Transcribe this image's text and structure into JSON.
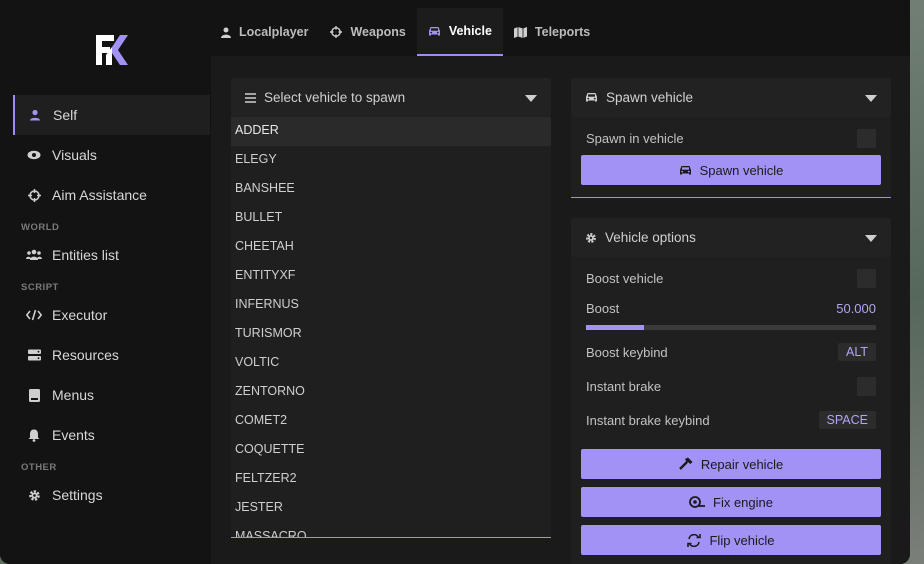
{
  "tabs": [
    {
      "label": "Localplayer",
      "icon": "user-icon"
    },
    {
      "label": "Weapons",
      "icon": "crosshair-icon"
    },
    {
      "label": "Vehicle",
      "icon": "car-icon"
    },
    {
      "label": "Teleports",
      "icon": "map-icon"
    }
  ],
  "active_tab": "Vehicle",
  "sidebar": {
    "items": [
      {
        "label": "Self",
        "icon": "user-icon"
      },
      {
        "label": "Visuals",
        "icon": "eye-icon"
      },
      {
        "label": "Aim Assistance",
        "icon": "crosshair-icon"
      },
      {
        "label": "Entities list",
        "icon": "users-icon"
      },
      {
        "label": "Executor",
        "icon": "code-icon"
      },
      {
        "label": "Resources",
        "icon": "server-icon"
      },
      {
        "label": "Menus",
        "icon": "book-icon"
      },
      {
        "label": "Events",
        "icon": "bell-icon"
      },
      {
        "label": "Settings",
        "icon": "gear-icon"
      }
    ],
    "sections": {
      "world": "WORLD",
      "script": "SCRIPT",
      "other": "OTHER"
    }
  },
  "vehicle_list": {
    "header": "Select vehicle to spawn",
    "items": [
      "ADDER",
      "ELEGY",
      "BANSHEE",
      "BULLET",
      "CHEETAH",
      "ENTITYXF",
      "INFERNUS",
      "TURISMOR",
      "VOLTIC",
      "ZENTORNO",
      "COMET2",
      "COQUETTE",
      "FELTZER2",
      "JESTER",
      "MASSACRO"
    ],
    "selected": "ADDER"
  },
  "spawn_panel": {
    "header": "Spawn vehicle",
    "spawn_in_vehicle_label": "Spawn in vehicle",
    "spawn_button": "Spawn vehicle"
  },
  "options_panel": {
    "header": "Vehicle options",
    "boost_vehicle_label": "Boost vehicle",
    "boost_label": "Boost",
    "boost_value": "50.000",
    "boost_fill_fraction": 0.2,
    "boost_keybind_label": "Boost keybind",
    "boost_keybind": "ALT",
    "instant_brake_label": "Instant brake",
    "instant_brake_keybind_label": "Instant brake keybind",
    "instant_brake_keybind": "SPACE",
    "repair_button": "Repair vehicle",
    "fix_engine_button": "Fix engine",
    "flip_button": "Flip vehicle"
  },
  "colors": {
    "accent": "#a392f5",
    "background": "#131313",
    "panel": "#1f1f1f"
  }
}
